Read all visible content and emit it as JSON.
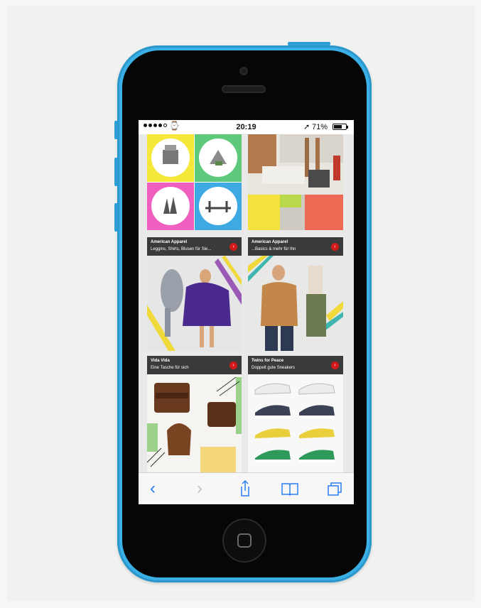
{
  "status_bar": {
    "time": "20:19",
    "battery": "71%",
    "battery_level": 0.71,
    "signal_bars": 4,
    "wifi_icon": "wifi-icon",
    "location_icon": "location-arrow-icon"
  },
  "tiles": [
    {
      "brand": "American Apparel",
      "description": "Leggins, Shirts, Blusen für Sie..."
    },
    {
      "brand": "American Apparel",
      "description": "...Basics & mehr für Ihn"
    },
    {
      "brand": "Vida Vida",
      "description": "Eine Tasche für sich"
    },
    {
      "brand": "Twins for Peace",
      "description": "Doppelt gute Sneakers"
    }
  ],
  "toolbar": {
    "back_icon": "chevron-left-icon",
    "forward_icon": "chevron-right-icon",
    "share_icon": "share-icon",
    "bookmarks_icon": "book-icon",
    "tabs_icon": "tabs-icon"
  },
  "colors": {
    "phone_body": "#3ab0e6",
    "accent_red": "#d21a1a",
    "ios_blue": "#2a7ff5",
    "tile_header": "#3a3a3a"
  }
}
